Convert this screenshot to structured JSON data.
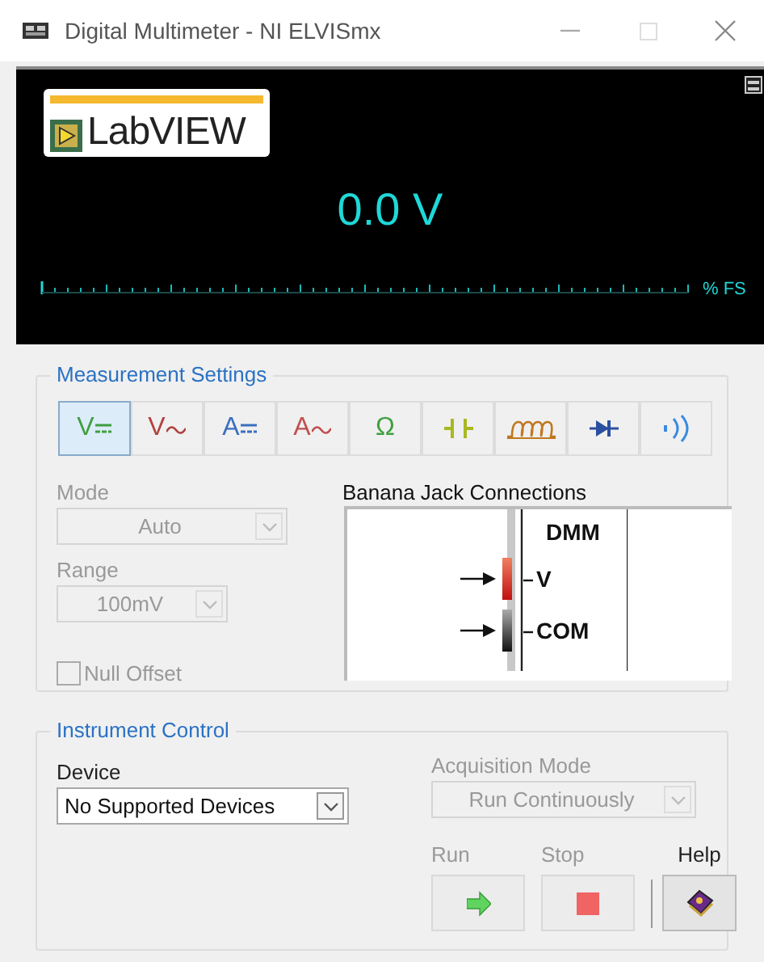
{
  "window": {
    "title": "Digital Multimeter - NI ELVISmx"
  },
  "display": {
    "logo": "LabVIEW",
    "reading": "0.0 V",
    "scale_unit": "% FS"
  },
  "measurement_settings": {
    "title": "Measurement Settings",
    "functions": [
      {
        "kind": "dc",
        "label": "V",
        "color": "#3f9f3f",
        "selected": true
      },
      {
        "kind": "ac",
        "label": "V",
        "color": "#b0413e",
        "selected": false
      },
      {
        "kind": "dc",
        "label": "A",
        "color": "#3a6fc0",
        "selected": false
      },
      {
        "kind": "ac",
        "label": "A",
        "color": "#c0504d",
        "selected": false
      },
      {
        "kind": "text",
        "label": "Ω",
        "color": "#3f9f3f",
        "selected": false
      },
      {
        "kind": "capacitor",
        "color": "#a8b820",
        "selected": false
      },
      {
        "kind": "inductor",
        "color": "#c07820",
        "selected": false
      },
      {
        "kind": "diode",
        "color": "#2a4fa0",
        "selected": false
      },
      {
        "kind": "continuity",
        "color": "#3a8ae0",
        "selected": false
      }
    ],
    "mode": {
      "label": "Mode",
      "value": "Auto",
      "disabled": true
    },
    "range": {
      "label": "Range",
      "value": "100mV",
      "disabled": true
    },
    "null_offset": {
      "label": "Null Offset",
      "checked": false,
      "disabled": true
    },
    "banana_jacks": {
      "title": "Banana Jack Connections",
      "header": "DMM",
      "jacks": [
        "V",
        "COM"
      ]
    }
  },
  "instrument_control": {
    "title": "Instrument Control",
    "device": {
      "label": "Device",
      "value": "No Supported Devices",
      "disabled": false
    },
    "acquisition_mode": {
      "label": "Acquisition Mode",
      "value": "Run Continuously",
      "disabled": true
    },
    "buttons": [
      {
        "kind": "run",
        "label": "Run"
      },
      {
        "kind": "stop",
        "label": "Stop"
      },
      {
        "kind": "help",
        "label": "Help"
      }
    ]
  }
}
